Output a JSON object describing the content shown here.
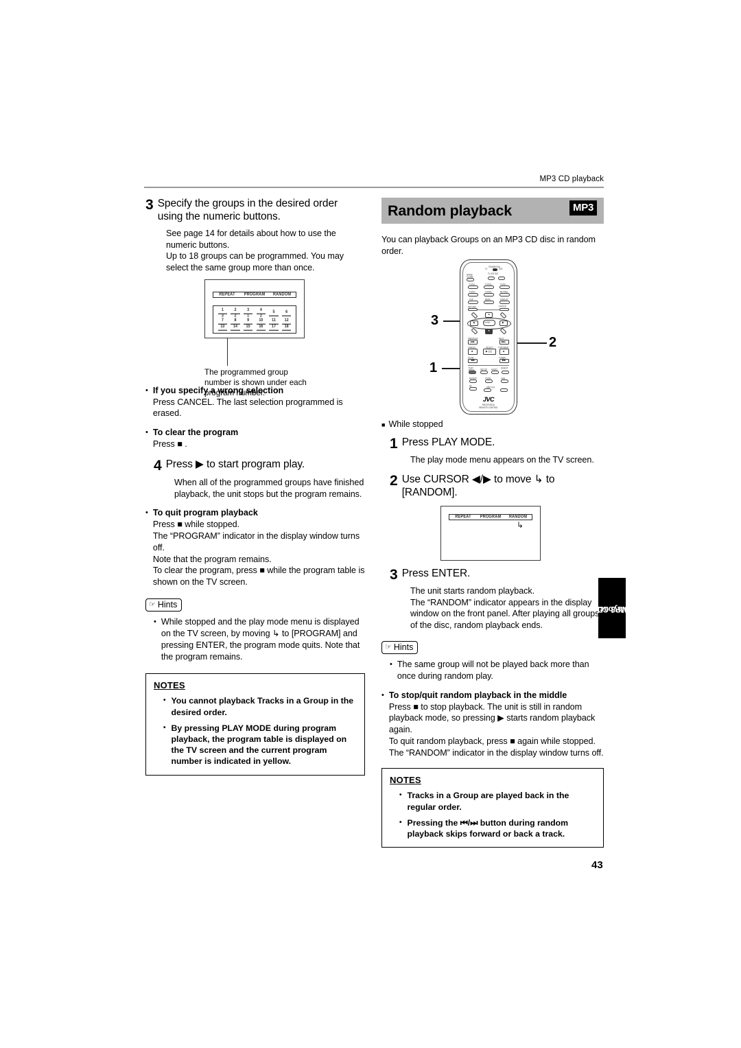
{
  "runhead": "MP3 CD playback",
  "page_number": "43",
  "side_tab": "MP3 CD\nplayback",
  "side_tab_line1": "MP3 CD",
  "side_tab_line2": "playback",
  "left_column": {
    "step3": {
      "num": "3",
      "text": "Specify the groups in the desired order using the numeric buttons.",
      "body1": "See page 14 for details about how to use the numeric buttons.",
      "body2": "Up to 18 groups can be programmed. You may select the same group more than once."
    },
    "program_table": {
      "menu": [
        "REPEAT",
        "PROGRAM",
        "RANDOM"
      ],
      "program_numbers": [
        "1",
        "2",
        "3",
        "4",
        "5",
        "6",
        "7",
        "8",
        "9",
        "10",
        "11",
        "12",
        "13",
        "14",
        "15",
        "16",
        "17",
        "18"
      ],
      "group_numbers": [
        "3",
        "2",
        "1",
        "2",
        "",
        "",
        "",
        "",
        "",
        "",
        "",
        "",
        "",
        "",
        "",
        "",
        "",
        ""
      ],
      "caption": "The programmed group number is shown under each program number."
    },
    "bullet_wrong": {
      "title": "If you specify a wrong selection",
      "body": "Press CANCEL. The last selection programmed is erased."
    },
    "bullet_clear": {
      "title": "To clear the program",
      "body": "Press ■ ."
    },
    "step4": {
      "num": "4",
      "text": "Press ▶ to start program play.",
      "body": "When all of the programmed groups have finished playback, the unit stops but the program remains."
    },
    "bullet_quit": {
      "title": "To quit program playback",
      "body": "Press ■ while stopped.\nThe “PROGRAM” indicator in the display window turns off.\nNote that the program remains.\nTo clear the program, press ■ while the program table is shown on the TV screen.",
      "line1": "Press ■ while stopped.",
      "line2": "The “PROGRAM” indicator in the display window turns off.",
      "line3": "Note that the program remains.",
      "line4": "To clear the program, press ■ while the program table is shown on the TV screen."
    },
    "hints": {
      "label": "Hints",
      "items": [
        "While stopped and the play mode menu is displayed on the TV screen, by moving ↳ to [PROGRAM] and pressing ENTER, the program mode quits. Note that the program remains."
      ]
    },
    "notes": {
      "title": "NOTES",
      "items": [
        "You cannot playback Tracks in a Group in the desired order.",
        "By pressing PLAY MODE during program playback, the program table is displayed on the TV screen and the current program number is indicated in yellow."
      ]
    }
  },
  "right_column": {
    "section_title": "Random playback",
    "section_badge": "MP3",
    "intro": "You can playback Groups on an MP3 CD disc in random order.",
    "remote": {
      "callouts": [
        "3",
        "2",
        "1"
      ],
      "brand": "JVC",
      "model_line1": "RM-SXV501U",
      "model_line2": "REMOTE CONTROL",
      "labels": {
        "open_close": "OPEN/\nCLOSE",
        "standby": "STANDBY/ON",
        "tv_vcr_dvd": [
          "TV",
          "VCR",
          "DVD"
        ],
        "tv_power": "TV/POWER",
        "play_mode": "PLAY\nMODE",
        "enter": "ENTER",
        "select": "SELECT",
        "prev": "PREVIOUS",
        "next": "NEXT",
        "cancel": "CANCEL",
        "slow": "SLOW",
        "tuner": "TUNER",
        "setup": "SET UP",
        "audio": "AUDIO",
        "digest": "DIGEST",
        "amp_vol": "AMP VOL"
      }
    },
    "while_stopped": "While stopped",
    "step1": {
      "num": "1",
      "text": "Press PLAY MODE.",
      "body": "The play mode menu appears on the TV screen."
    },
    "step2": {
      "num": "2",
      "text": "Use CURSOR ◀/▶ to move ↳ to [RANDOM]."
    },
    "tv_menu": [
      "REPEAT",
      "PROGRAM",
      "RANDOM"
    ],
    "step3": {
      "num": "3",
      "text": "Press ENTER.",
      "body": "The unit starts random playback.\nThe “RANDOM” indicator appears in the display window on the front panel. After playing all groups of the disc, random playback ends.",
      "line1": "The unit starts random playback.",
      "line2": "The “RANDOM” indicator appears in the display window on the front panel. After playing all groups of the disc, random playback ends."
    },
    "hints": {
      "label": "Hints",
      "items": [
        "The same group will not be played back more than once during random play."
      ]
    },
    "bullet_stopquit": {
      "title": "To stop/quit random playback in the middle",
      "line1": "Press ■ to stop playback. The unit is still in random playback mode, so pressing ▶ starts random playback again.",
      "line2": "To quit random playback, press ■ again while stopped. The “RANDOM” indicator in the display window turns off."
    },
    "notes": {
      "title": "NOTES",
      "items": [
        "Tracks in a Group are played back in the regular order.",
        "Pressing the ⏮/⏭ button during random playback skips forward or back a track."
      ]
    }
  },
  "colors": {
    "header_band": "#b2b2b2",
    "badge_bg": "#000000",
    "rule": "#9a9a9a",
    "text": "#000000"
  }
}
